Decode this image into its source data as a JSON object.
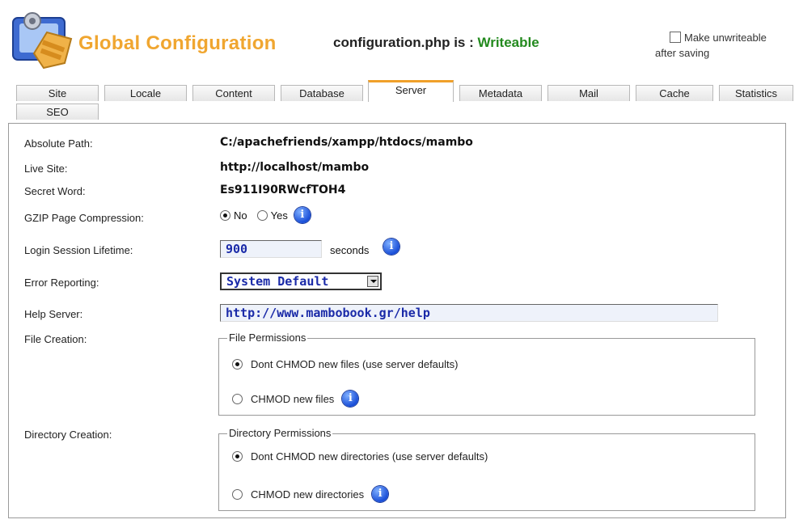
{
  "header": {
    "title": "Global Configuration",
    "status_prefix": "configuration.php is : ",
    "status_value": "Writeable",
    "make_unwriteable_line1": "Make unwriteable",
    "make_unwriteable_line2": "after saving"
  },
  "tabs": [
    {
      "label": "Site",
      "active": false
    },
    {
      "label": "Locale",
      "active": false
    },
    {
      "label": "Content",
      "active": false
    },
    {
      "label": "Database",
      "active": false
    },
    {
      "label": "Server",
      "active": true
    },
    {
      "label": "Metadata",
      "active": false
    },
    {
      "label": "Mail",
      "active": false
    },
    {
      "label": "Cache",
      "active": false
    },
    {
      "label": "Statistics",
      "active": false
    },
    {
      "label": "SEO",
      "active": false
    }
  ],
  "form": {
    "absolute_path": {
      "label": "Absolute Path:",
      "value": "C:/apachefriends/xampp/htdocs/mambo"
    },
    "live_site": {
      "label": "Live Site:",
      "value": "http://localhost/mambo"
    },
    "secret_word": {
      "label": "Secret Word:",
      "value": "Es911I90RWcfTOH4"
    },
    "gzip": {
      "label": "GZIP Page Compression:",
      "no": "No",
      "yes": "Yes",
      "selected": "No"
    },
    "session": {
      "label": "Login Session Lifetime:",
      "value": "900",
      "unit": "seconds"
    },
    "error_reporting": {
      "label": "Error Reporting:",
      "value": "System Default"
    },
    "help_server": {
      "label": "Help Server:",
      "value": "http://www.mambobook.gr/help"
    },
    "file_creation": {
      "label": "File Creation:",
      "legend": "File Permissions",
      "option1": "Dont CHMOD new files (use server defaults)",
      "option2": "CHMOD new files",
      "selected": 1
    },
    "directory_creation": {
      "label": "Directory Creation:",
      "legend": "Directory Permissions",
      "option1": "Dont CHMOD new directories (use server defaults)",
      "option2": "CHMOD new directories",
      "selected": 1
    }
  },
  "icons": {
    "logo": "configuration-logo-icon",
    "info": "info-icon"
  },
  "colors": {
    "title": "#f0a630",
    "writeable": "#238a1e",
    "active_tab": "#f0a02a",
    "info": "#1a4fd8"
  }
}
